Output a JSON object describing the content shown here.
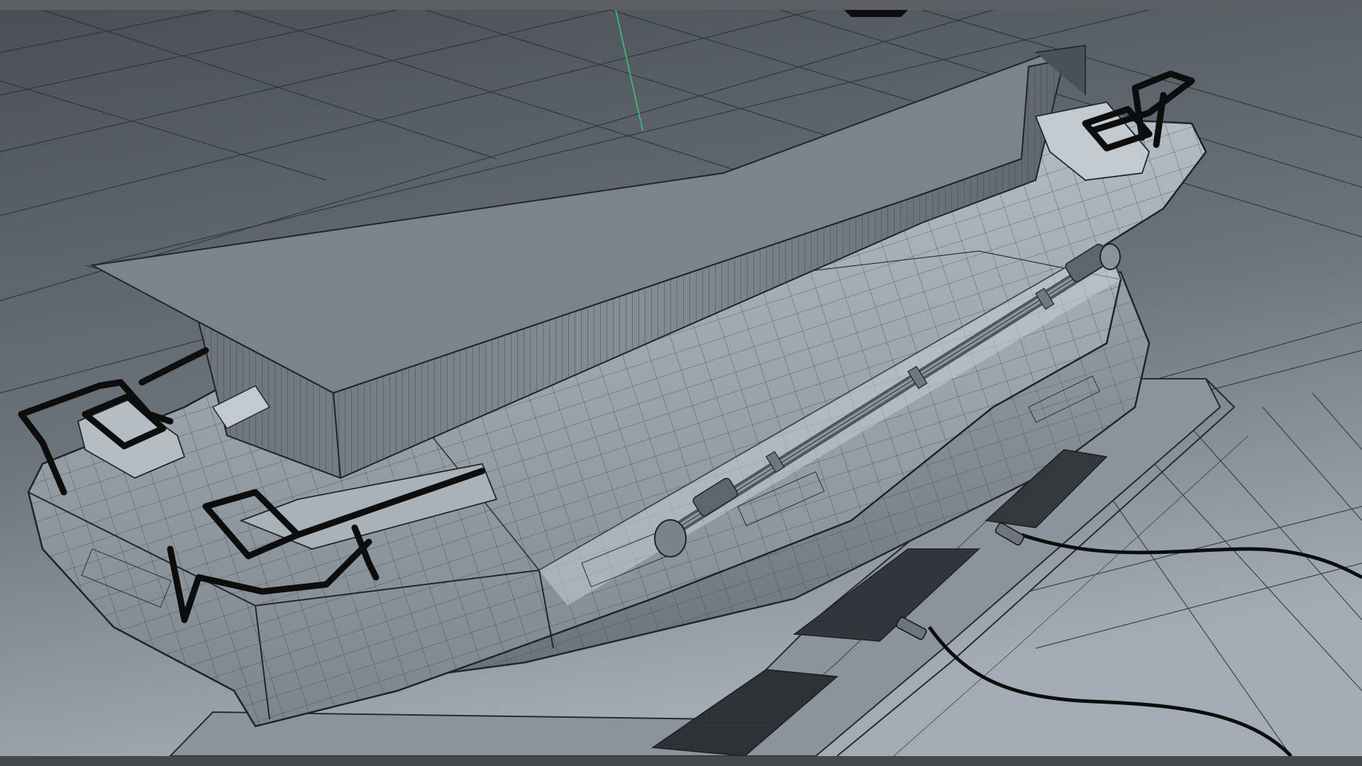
{
  "viewport": {
    "name": "3d-perspective-viewport",
    "colors": {
      "background_top": "#4b5056",
      "background_bottom": "#9aa3ab",
      "grid_line": "#2c2f33",
      "mesh_fill_light": "#aeb6bd",
      "mesh_fill_mid": "#8a939b",
      "mesh_fill_dark": "#5d646b",
      "wireframe": "#2b2f33",
      "curve_black": "#0d0d0d",
      "y_axis": "#3fbf7f",
      "frame_bar": "#5c5f63"
    },
    "objects": [
      {
        "name": "main-body-hull"
      },
      {
        "name": "upper-block-box"
      },
      {
        "name": "rear-base-skirt"
      },
      {
        "name": "hydraulic-piston-rod"
      },
      {
        "name": "power-cable-left"
      },
      {
        "name": "power-cable-right"
      },
      {
        "name": "roll-cage-bar-left"
      },
      {
        "name": "roll-cage-bar-right"
      }
    ]
  }
}
